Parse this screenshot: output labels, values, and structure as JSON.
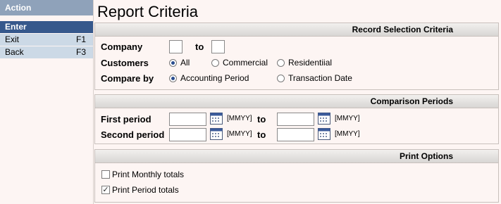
{
  "sidebar": {
    "header": "Action",
    "items": [
      {
        "label": "Enter",
        "key": ""
      },
      {
        "label": "Exit",
        "key": "F1"
      },
      {
        "label": "Back",
        "key": "F3"
      }
    ]
  },
  "page": {
    "title": "Report Criteria"
  },
  "record_selection": {
    "header": "Record Selection Criteria",
    "company_label": "Company",
    "company_from": "",
    "to_label": "to",
    "company_to": "",
    "customers_label": "Customers",
    "customer_options": [
      "All",
      "Commercial",
      "Residentiial"
    ],
    "customer_selected": "All",
    "compare_label": "Compare by",
    "compare_options": [
      "Accounting Period",
      "Transaction Date"
    ],
    "compare_selected": "Accounting Period"
  },
  "comparison": {
    "header": "Comparison Periods",
    "first_label": "First period",
    "second_label": "Second period",
    "to_label": "to",
    "format_hint": "[MMYY]",
    "first_from": "",
    "first_to": "",
    "second_from": "",
    "second_to": ""
  },
  "print_options": {
    "header": "Print Options",
    "monthly_label": "Print Monthly totals",
    "monthly_checked": false,
    "period_label": "Print Period totals",
    "period_checked": true
  }
}
